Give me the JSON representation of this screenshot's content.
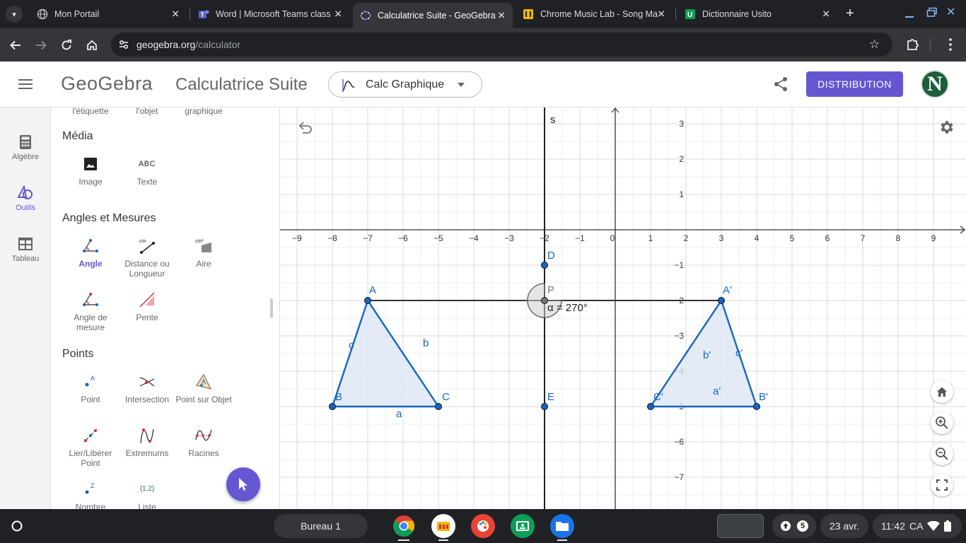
{
  "browser": {
    "tabs": [
      {
        "title": "Mon Portail",
        "active": false
      },
      {
        "title": "Word | Microsoft Teams class",
        "active": false
      },
      {
        "title": "Calculatrice Suite - GeoGebra",
        "active": true
      },
      {
        "title": "Chrome Music Lab - Song Ma",
        "active": false
      },
      {
        "title": "Dictionnaire Usito",
        "active": false
      }
    ],
    "url_domain": "geogebra.org",
    "url_path": "/calculator"
  },
  "header": {
    "logo": "GeoGebra",
    "app_title": "Calculatrice Suite",
    "app_select": "Calc Graphique",
    "distribution_label": "DISTRIBUTION",
    "avatar_letter": "N",
    "accent": "#6557d2"
  },
  "rail": {
    "items": [
      {
        "label": "Algèbre",
        "icon": "calculator-icon"
      },
      {
        "label": "Outils",
        "icon": "tools-icon"
      },
      {
        "label": "Tableau",
        "icon": "table-icon"
      }
    ]
  },
  "tools": {
    "cut_labels": [
      "l'étiquette",
      "l'objet",
      "graphique"
    ],
    "sections": [
      {
        "title": "Média",
        "items": [
          {
            "label": "Image",
            "icon": "image-icon"
          },
          {
            "label": "Texte",
            "icon": "text-icon",
            "glyph": "ABC"
          }
        ]
      },
      {
        "title": "Angles et Mesures",
        "items": [
          {
            "label": "Angle",
            "icon": "angle-icon",
            "selected": true
          },
          {
            "label": "Distance ou Longueur",
            "icon": "distance-icon",
            "glyph": "cm"
          },
          {
            "label": "Aire",
            "icon": "area-icon",
            "glyph": "cm²"
          },
          {
            "label": "Angle de mesure",
            "icon": "angle-given-size-icon"
          },
          {
            "label": "Pente",
            "icon": "slope-icon"
          }
        ]
      },
      {
        "title": "Points",
        "items": [
          {
            "label": "Point",
            "icon": "point-icon",
            "glyph": "A"
          },
          {
            "label": "Intersection",
            "icon": "intersection-icon"
          },
          {
            "label": "Point sur Objet",
            "icon": "point-on-object-icon",
            "glyph": "A"
          },
          {
            "label": "Lier/Libérer Point",
            "icon": "attach-detach-icon"
          },
          {
            "label": "Extremums",
            "icon": "extremum-icon"
          },
          {
            "label": "Racines",
            "icon": "roots-icon"
          },
          {
            "label": "Nombre",
            "icon": "number-icon",
            "glyph": "Z"
          },
          {
            "label": "Liste",
            "icon": "list-icon",
            "glyph": "{1,2}"
          }
        ]
      }
    ]
  },
  "graphics": {
    "x_ticks": [
      "−9",
      "−8",
      "−7",
      "−6",
      "−5",
      "−4",
      "−3",
      "−2",
      "−1",
      "0",
      "1",
      "2",
      "3",
      "4",
      "5",
      "6",
      "7",
      "8",
      "9"
    ],
    "y_ticks": [
      "3",
      "2",
      "1",
      "−1",
      "−2",
      "−3",
      "−4",
      "−5",
      "−6",
      "−7"
    ],
    "y_axis_label": "s",
    "points": [
      {
        "name": "A",
        "x": -7,
        "y": -2
      },
      {
        "name": "B",
        "x": -8,
        "y": -5
      },
      {
        "name": "C",
        "x": -5,
        "y": -5
      },
      {
        "name": "D",
        "x": -2,
        "y": -1
      },
      {
        "name": "E",
        "x": -2,
        "y": -5
      },
      {
        "name": "P",
        "x": -2,
        "y": -2
      },
      {
        "name": "A'",
        "x": 3,
        "y": -2
      },
      {
        "name": "B'",
        "x": 4,
        "y": -5
      },
      {
        "name": "C'",
        "x": 1,
        "y": -5
      }
    ],
    "segment_labels": [
      "a",
      "b",
      "c",
      "a'",
      "b'",
      "c'"
    ],
    "angle_label": "α = 270°",
    "colors": {
      "triangle": "#1565c0",
      "fill": "#dde6f4",
      "point": "#1565c0",
      "grid": "#e8e8e8"
    }
  },
  "taskbar": {
    "desk_label": "Bureau 1",
    "notif_count": "5",
    "date": "23 avr.",
    "time": "11:42",
    "locale": "CA"
  }
}
